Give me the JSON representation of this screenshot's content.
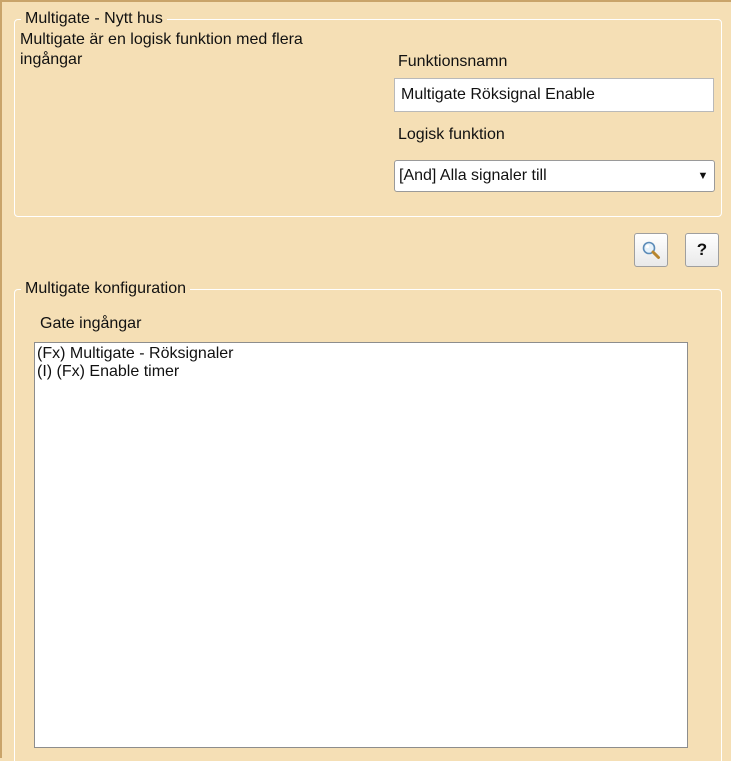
{
  "top_group": {
    "legend": "Multigate - Nytt hus",
    "description": "Multigate är en logisk funktion med flera ingångar",
    "name_label": "Funktionsnamn",
    "name_value": "Multigate Röksignal Enable",
    "function_label": "Logisk funktion",
    "function_value": "[And] Alla signaler till"
  },
  "toolbar": {
    "search_icon": "magnifier-icon",
    "help_label": "?"
  },
  "config_group": {
    "legend": "Multigate konfiguration",
    "inputs_label": "Gate ingångar",
    "inputs": [
      "(Fx) Multigate - Röksignaler",
      "(I) (Fx) Enable timer"
    ]
  },
  "colors": {
    "background": "#f5dfb5",
    "panel_border": "#ffffff"
  }
}
